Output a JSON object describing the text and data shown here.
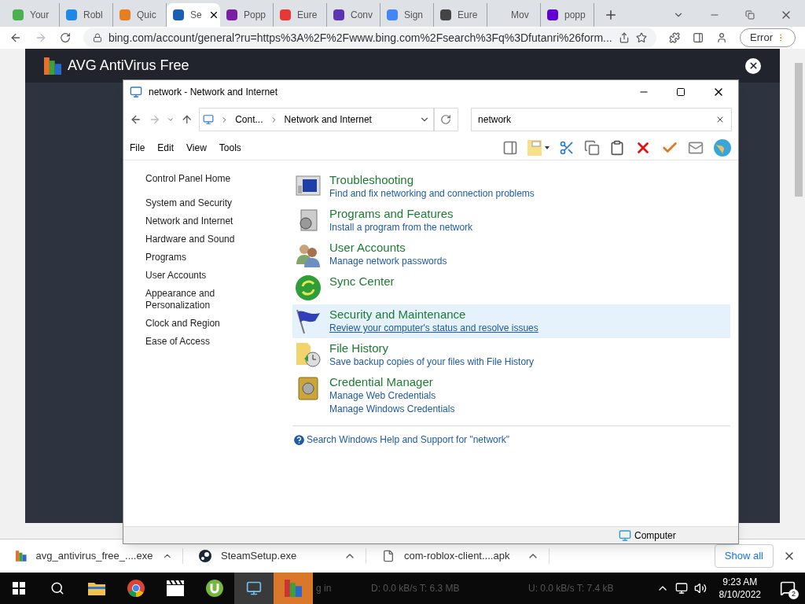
{
  "browser": {
    "tabs": [
      {
        "title": "Your",
        "selected": false,
        "color": "#4caf50"
      },
      {
        "title": "Robl",
        "selected": false,
        "color": "#1e88e5"
      },
      {
        "title": "Quic",
        "selected": false,
        "color": "#e67e22"
      },
      {
        "title": "Se",
        "selected": true,
        "color": "#1a5fb4"
      },
      {
        "title": "Popp",
        "selected": false,
        "color": "#7b1fa2"
      },
      {
        "title": "Eure",
        "selected": false,
        "color": "#e53935"
      },
      {
        "title": "Conv",
        "selected": false,
        "color": "#5e35b1"
      },
      {
        "title": "Sign",
        "selected": false,
        "color": "#4285f4"
      },
      {
        "title": "Eure",
        "selected": false,
        "color": "#444444"
      },
      {
        "title": "Mov",
        "selected": false
      },
      {
        "title": "popp",
        "selected": false,
        "color": "#6001d2"
      }
    ],
    "url": "bing.com/account/general?ru=https%3A%2F%2Fwww.bing.com%2Fsearch%3Fq%3Dfutanri%26form...",
    "error_label": "Error"
  },
  "avg": {
    "title": "AVG AntiVirus Free"
  },
  "explorer": {
    "title": "network - Network and Internet",
    "breadcrumb": [
      "Cont...",
      "Network and Internet"
    ],
    "search": {
      "value": "network"
    },
    "menu": [
      "File",
      "Edit",
      "View",
      "Tools"
    ],
    "sidebar": [
      "Control Panel Home",
      "System and Security",
      "Network and Internet",
      "Hardware and Sound",
      "Programs",
      "User Accounts",
      "Appearance and Personalization",
      "Clock and Region",
      "Ease of Access"
    ],
    "results": [
      {
        "kind": "troubleshoot",
        "title": "Troubleshooting",
        "links": [
          "Find and fix networking and connection problems"
        ],
        "highlighted": false
      },
      {
        "kind": "programs",
        "title": "Programs and Features",
        "links": [
          "Install a program from the network"
        ],
        "highlighted": false
      },
      {
        "kind": "users",
        "title": "User Accounts",
        "links": [
          "Manage network passwords"
        ],
        "highlighted": false
      },
      {
        "kind": "sync",
        "title": "Sync Center",
        "highlighted": false
      },
      {
        "kind": "flag",
        "title": "Security and Maintenance",
        "links": [
          "Review your computer's status and resolve issues"
        ],
        "highlighted": true
      },
      {
        "kind": "history",
        "title": "File History",
        "links": [
          "Save backup copies of your files with File History"
        ],
        "highlighted": false
      },
      {
        "kind": "vault",
        "title": "Credential Manager",
        "links": [
          "Manage Web Credentials",
          "Manage Windows Credentials"
        ],
        "highlighted": false
      }
    ],
    "help_link": "Search Windows Help and Support for \"network\"",
    "status": "Computer"
  },
  "downloads": {
    "files": [
      {
        "kind": "avg",
        "name": "avg_antivirus_free_....exe"
      },
      {
        "kind": "steam",
        "name": "SteamSetup.exe"
      },
      {
        "kind": "file",
        "name": "com-roblox-client....apk"
      }
    ],
    "show_all": "Show all"
  },
  "taskbar": {
    "overlay_texts": [
      "g in",
      "D: 0.0 kB/s T: 6.3 MB",
      "U: 0.0 kB/s T: 7.4 kB"
    ],
    "time": "9:23 AM",
    "date": "8/10/2022",
    "notifications": "2"
  }
}
